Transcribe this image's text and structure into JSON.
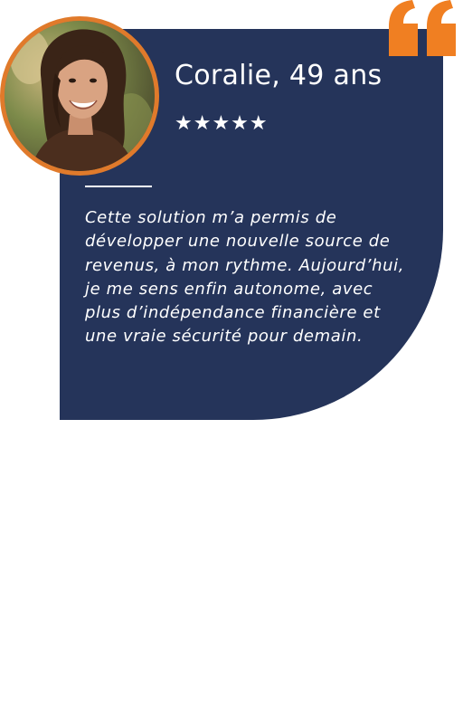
{
  "testimonial": {
    "name": "Coralie, 49 ans",
    "stars": "★★★★★",
    "rating": 5,
    "quote": "Cette solution m’a permis de développer une nouvelle source de revenus, à mon rythme. Aujourd’hui, je me sens enfin autonome, avec plus d’indépendance financière et une vraie sécurité pour demain."
  },
  "colors": {
    "card_background": "#25345a",
    "accent": "#f07f22",
    "avatar_border": "#e07a2b",
    "text": "#ffffff"
  },
  "icons": {
    "quote": "quote-mark-icon",
    "avatar": "avatar-photo"
  }
}
